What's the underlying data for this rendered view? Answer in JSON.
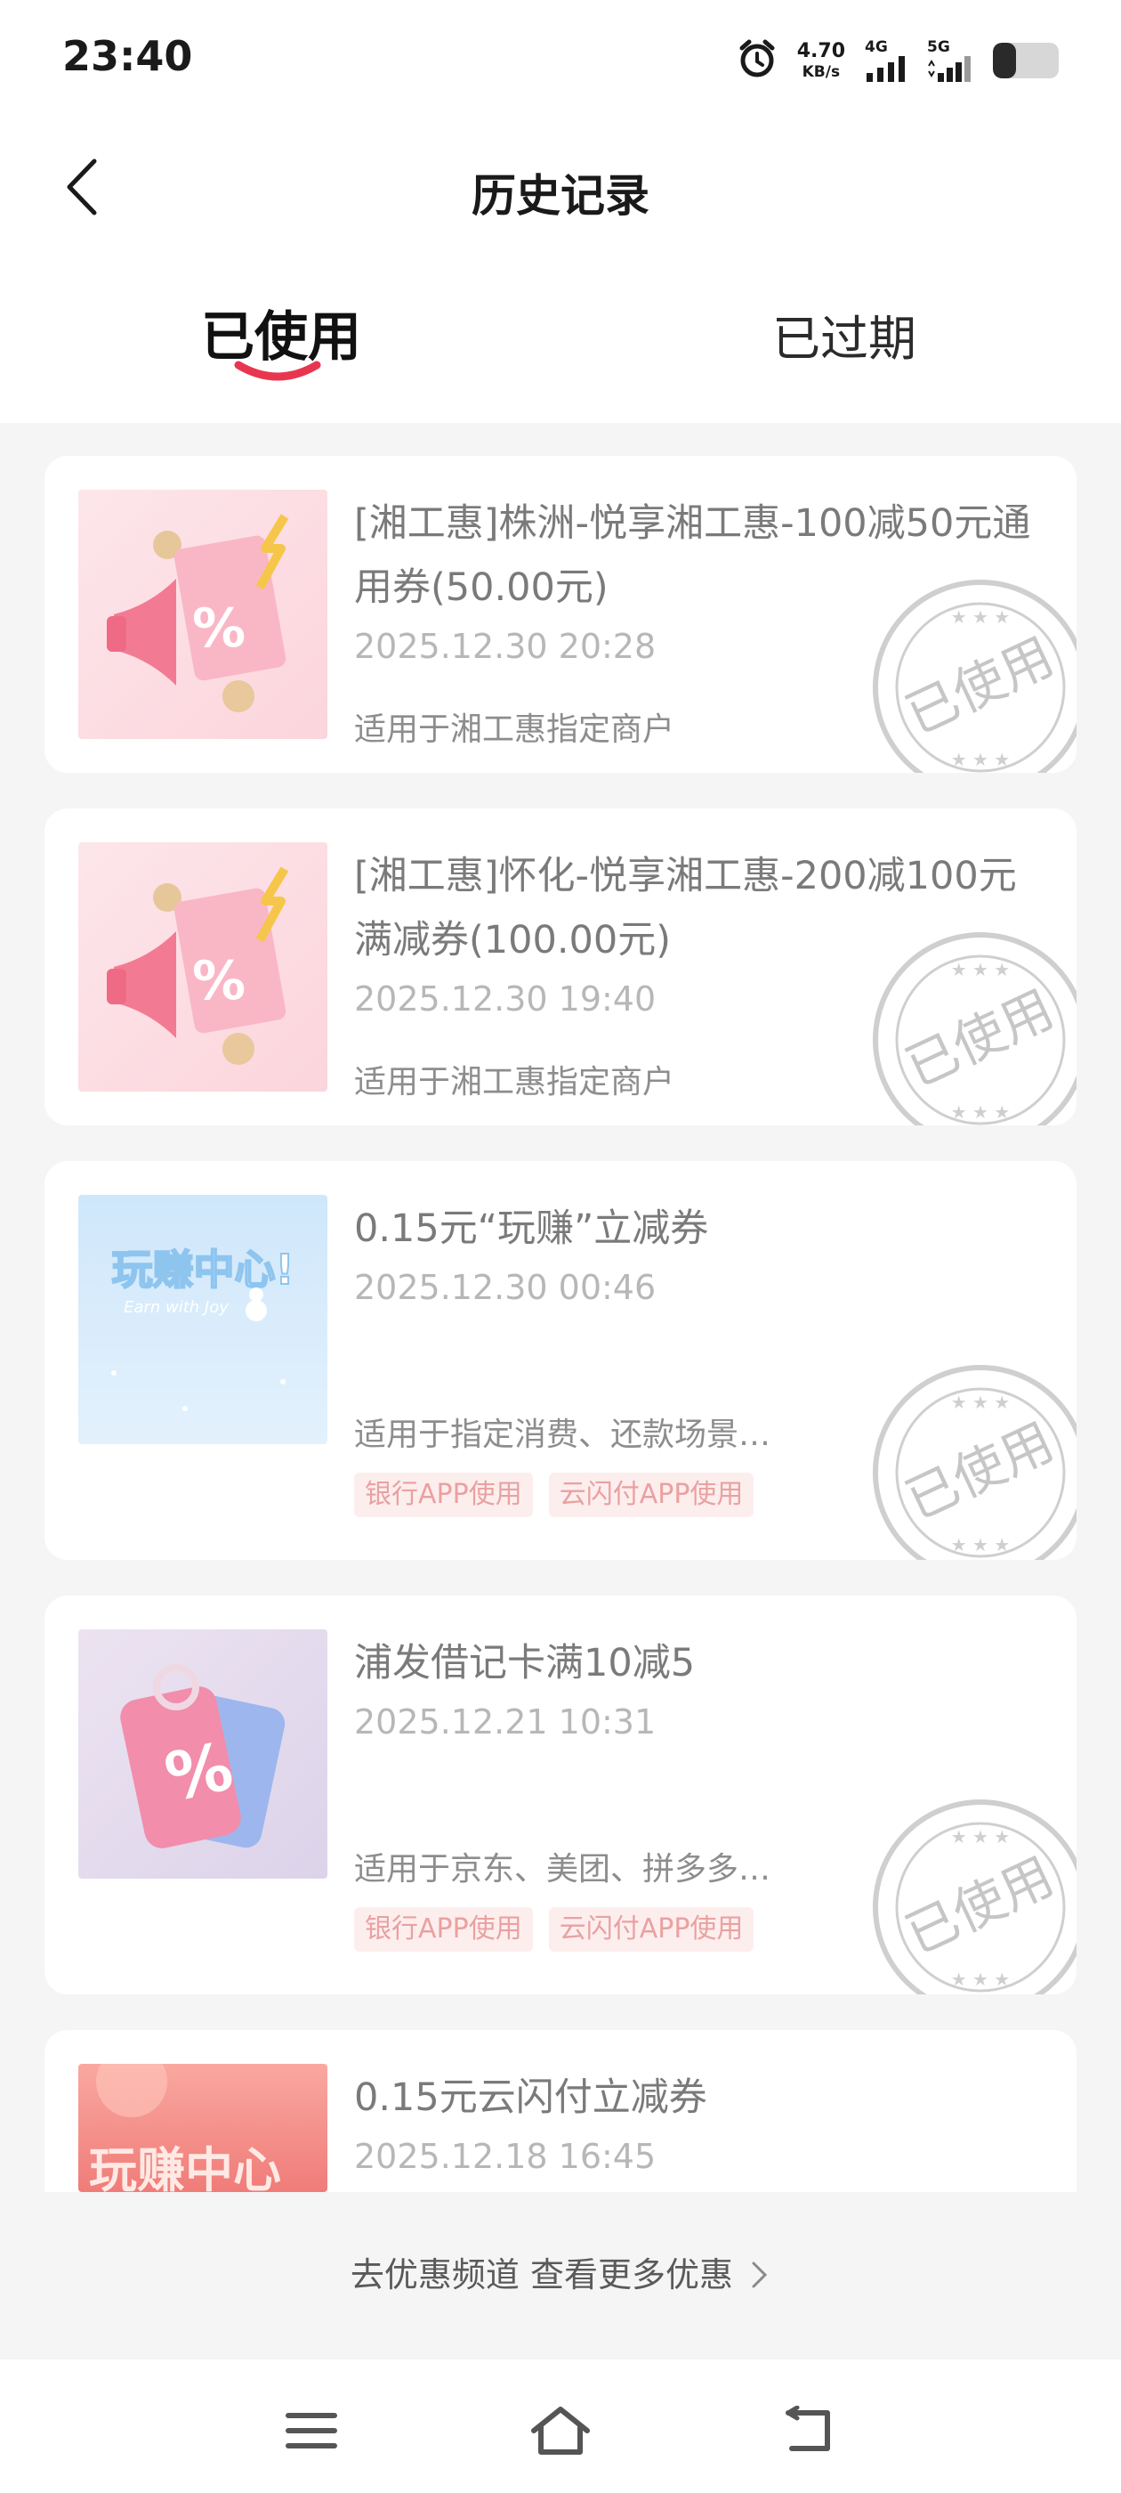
{
  "status_bar": {
    "time": "23:40",
    "net_speed_value": "4.70",
    "net_speed_unit": "KB/s",
    "signal1_label": "4G",
    "signal2_label": "5G",
    "battery_level": 0.35
  },
  "header": {
    "title": "历史记录"
  },
  "tabs": [
    {
      "label": "已使用",
      "active": true
    },
    {
      "label": "已过期",
      "active": false
    }
  ],
  "stamp_text": "已使用",
  "coupons": [
    {
      "title": "[湘工惠]株洲-悦享湘工惠-100减50元通用券(50.00元)",
      "date": "2025.12.30 20:28",
      "desc": "适用于湘工惠指定商户",
      "tags": [],
      "thumb_icon": "megaphone-coupon-icon"
    },
    {
      "title": "[湘工惠]怀化-悦享湘工惠-200减100元满减券(100.00元)",
      "date": "2025.12.30 19:40",
      "desc": "适用于湘工惠指定商户",
      "tags": [],
      "thumb_icon": "megaphone-coupon-icon"
    },
    {
      "title": "0.15元“玩赚”立减券",
      "date": "2025.12.30 00:46",
      "desc": "适用于指定消费、还款场景…",
      "tags": [
        "银行APP使用",
        "云闪付APP使用"
      ],
      "thumb_title": "玩赚中心!",
      "thumb_sub": "Earn with Joy"
    },
    {
      "title": "浦发借记卡满10减5",
      "date": "2025.12.21 10:31",
      "desc": "适用于京东、美团、拼多多…",
      "tags": [
        "银行APP使用",
        "云闪付APP使用"
      ],
      "thumb_icon": "percent-tag-icon"
    },
    {
      "title": "0.15元云闪付立减券",
      "date": "2025.12.18 16:45",
      "thumb_title": "玩赚中心"
    }
  ],
  "footer": {
    "more_link": "去优惠频道 查看更多优惠"
  },
  "colors": {
    "accent_underline": "#e8364f",
    "tag_bg": "#fdeeee",
    "tag_text": "#e9a1a1",
    "stamp": "#cfcfcf"
  }
}
